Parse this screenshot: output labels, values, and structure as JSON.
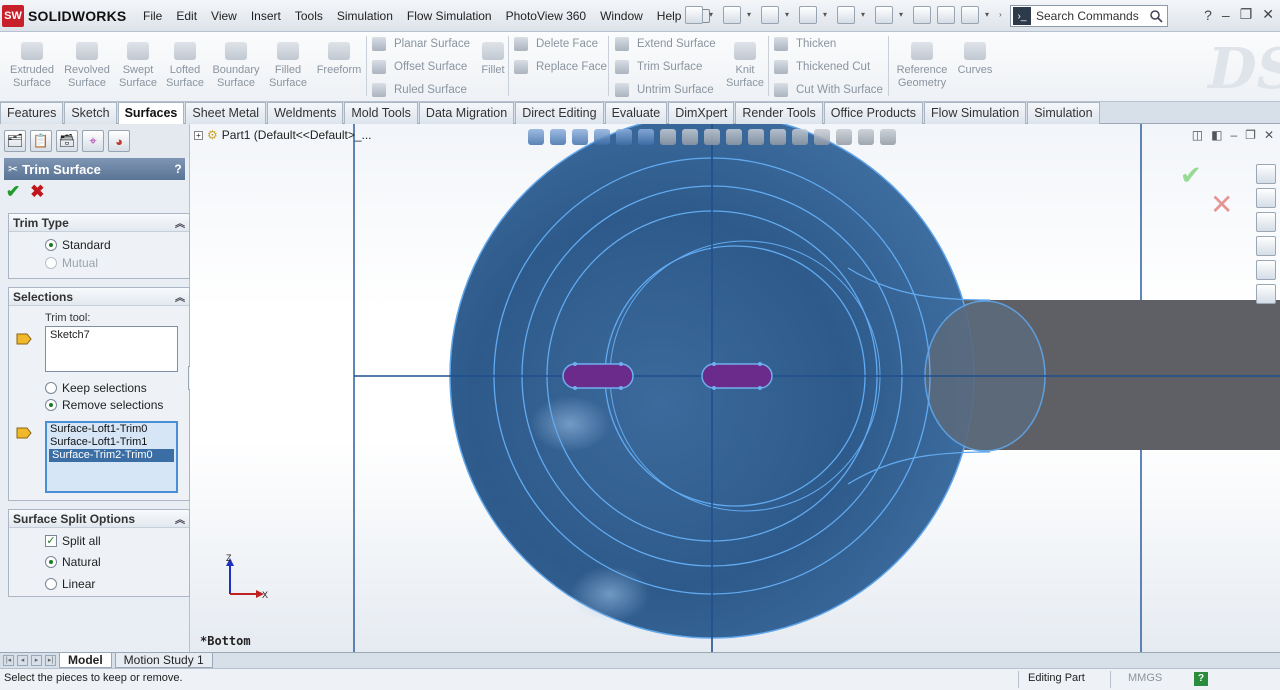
{
  "app": {
    "logo_text": "SOLIDWORKS"
  },
  "menu": [
    "File",
    "Edit",
    "View",
    "Insert",
    "Tools",
    "Simulation",
    "Flow Simulation",
    "PhotoView 360",
    "Window",
    "Help"
  ],
  "search": {
    "placeholder": "Search Commands"
  },
  "commands": {
    "extruded": [
      "Extruded",
      "Surface"
    ],
    "revolved": [
      "Revolved",
      "Surface"
    ],
    "swept": [
      "Swept",
      "Surface"
    ],
    "lofted": [
      "Lofted",
      "Surface"
    ],
    "boundary": [
      "Boundary",
      "Surface"
    ],
    "filled": [
      "Filled",
      "Surface"
    ],
    "freeform": "Freeform",
    "planar": "Planar Surface",
    "offset": "Offset Surface",
    "ruled": "Ruled Surface",
    "fillet": "Fillet",
    "delete_face": "Delete Face",
    "replace_face": "Replace Face",
    "extend": "Extend Surface",
    "trim": "Trim Surface",
    "untrim": "Untrim Surface",
    "knit": [
      "Knit",
      "Surface"
    ],
    "thicken": "Thicken",
    "thickened_cut": "Thickened Cut",
    "cut_with_surface": "Cut With Surface",
    "ref_geom": [
      "Reference",
      "Geometry"
    ],
    "curves": "Curves"
  },
  "tabs": [
    "Features",
    "Sketch",
    "Surfaces",
    "Sheet Metal",
    "Weldments",
    "Mold Tools",
    "Data Migration",
    "Direct Editing",
    "Evaluate",
    "DimXpert",
    "Render Tools",
    "Office Products",
    "Flow Simulation",
    "Simulation"
  ],
  "active_tab": "Surfaces",
  "property_manager": {
    "title": "Trim Surface",
    "help": "?",
    "trim_type": {
      "header": "Trim Type",
      "standard": "Standard",
      "mutual": "Mutual"
    },
    "selections": {
      "header": "Selections",
      "trim_tool_label": "Trim tool:",
      "trim_tool_value": "Sketch7",
      "keep": "Keep selections",
      "remove": "Remove selections",
      "pieces": [
        "Surface-Loft1-Trim0",
        "Surface-Loft1-Trim1",
        "Surface-Trim2-Trim0"
      ]
    },
    "split_options": {
      "header": "Surface Split Options",
      "split_all": "Split all",
      "natural": "Natural",
      "linear": "Linear"
    }
  },
  "feature_tree": {
    "item": "Part1  (Default<<Default>_..."
  },
  "viewport": {
    "view_name": "*Bottom",
    "triad_z": "Z",
    "triad_x": "X"
  },
  "bottom_tabs": [
    "Model",
    "Motion Study 1"
  ],
  "status": {
    "message": "Select the pieces to keep or remove.",
    "editing": "Editing Part",
    "units": "MMGS"
  }
}
